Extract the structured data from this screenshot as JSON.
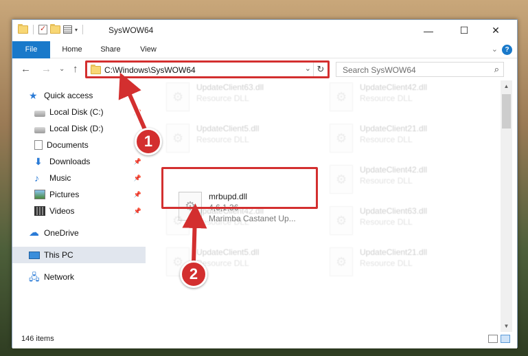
{
  "window": {
    "title": "SysWOW64",
    "controls": {
      "minimize": "—",
      "maximize": "☐",
      "close": "✕"
    }
  },
  "ribbon": {
    "tabs": [
      {
        "label": "File"
      },
      {
        "label": "Home"
      },
      {
        "label": "Share"
      },
      {
        "label": "View"
      }
    ],
    "help": "?",
    "collapse": "⌄"
  },
  "navigation": {
    "back": "←",
    "forward": "→",
    "recent": "⌄",
    "up": "↑",
    "address": "C:\\Windows\\SysWOW64",
    "address_dropdown": "⌄",
    "refresh": "↻",
    "search_placeholder": "Search SysWOW64",
    "search_icon": "⌕"
  },
  "sidebar": {
    "items": [
      {
        "label": "Quick access",
        "icon": "star-icon"
      },
      {
        "label": "Local Disk (C:)",
        "icon": "disk-icon"
      },
      {
        "label": "Local Disk (D:)",
        "icon": "disk-icon"
      },
      {
        "label": "Documents",
        "icon": "documents-icon"
      },
      {
        "label": "Downloads",
        "icon": "download-icon"
      },
      {
        "label": "Music",
        "icon": "music-icon"
      },
      {
        "label": "Pictures",
        "icon": "pictures-icon"
      },
      {
        "label": "Videos",
        "icon": "videos-icon"
      },
      {
        "label": "OneDrive",
        "icon": "cloud-icon"
      },
      {
        "label": "This PC",
        "icon": "computer-icon",
        "selected": true
      },
      {
        "label": "Network",
        "icon": "network-icon"
      }
    ]
  },
  "files": {
    "left": [
      {
        "name": "UpdateClient63.dll",
        "type": "Resource DLL"
      },
      {
        "name": "UpdateClient5.dll",
        "type": "Resource DLL"
      },
      {
        "name": "mrbupd.dll",
        "version": "4,6,1,36",
        "description": "Marimba Castanet Up..."
      },
      {
        "name": "UpdateClient42.dll",
        "type": "Resource DLL"
      },
      {
        "name": "UpdateClient5.dll",
        "type": "Resource DLL"
      }
    ],
    "right": [
      {
        "name": "UpdateClient42.dll",
        "type": "Resource DLL"
      },
      {
        "name": "UpdateClient21.dll",
        "type": "Resource DLL"
      },
      {
        "name": "UpdateClient42.dll",
        "type": "Resource DLL"
      },
      {
        "name": "UpdateClient63.dll",
        "type": "Resource DLL"
      },
      {
        "name": "UpdateClient21.dll",
        "type": "Resource DLL"
      }
    ]
  },
  "status": {
    "count": "146 items"
  },
  "callouts": {
    "first": "1",
    "second": "2"
  },
  "colors": {
    "accent": "#1979ca",
    "highlight": "#d32f2f"
  }
}
